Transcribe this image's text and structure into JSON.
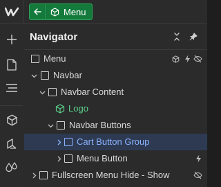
{
  "topbar": {
    "logo_icon": "webflow-logo-icon",
    "back_icon": "arrow-left-icon",
    "breadcrumb": {
      "icon": "component-cube-icon",
      "label": "Menu"
    }
  },
  "rail": {
    "items": [
      {
        "name": "add-icon"
      },
      {
        "name": "pages-icon"
      },
      {
        "name": "navigator-icon"
      },
      {
        "name": "components-icon"
      },
      {
        "name": "style-manager-icon"
      },
      {
        "name": "color-swatches-icon"
      }
    ]
  },
  "navigator": {
    "title": "Navigator",
    "collapse_icon": "collapse-icon",
    "pin_icon": "pin-icon",
    "tree": [
      {
        "label": "Menu",
        "depth": 0,
        "caret": "none",
        "icon": "box",
        "trailing": [
          "component-icon",
          "interaction-icon",
          "hidden-icon"
        ]
      },
      {
        "label": "Navbar",
        "depth": 1,
        "caret": "down",
        "icon": "box"
      },
      {
        "label": "Navbar Content",
        "depth": 2,
        "caret": "down",
        "icon": "box"
      },
      {
        "label": "Logo",
        "depth": 3,
        "caret": "none",
        "icon": "component",
        "color": "#5cd18b"
      },
      {
        "label": "Navbar Buttons",
        "depth": 3,
        "caret": "down",
        "icon": "box"
      },
      {
        "label": "Cart Button Group",
        "depth": 4,
        "caret": "right",
        "icon": "box",
        "selected": true
      },
      {
        "label": "Menu Button",
        "depth": 4,
        "caret": "right",
        "icon": "box",
        "trailing": [
          "interaction-icon"
        ]
      },
      {
        "label": "Fullscreen Menu Hide - Show",
        "depth": 1,
        "caret": "right",
        "icon": "box",
        "trailing": [
          "hidden-icon"
        ]
      }
    ]
  },
  "colors": {
    "accent_green": "#147a3c",
    "selection": "#2e3a52",
    "selected_text": "#8ab4ff",
    "component_green": "#5cd18b"
  }
}
